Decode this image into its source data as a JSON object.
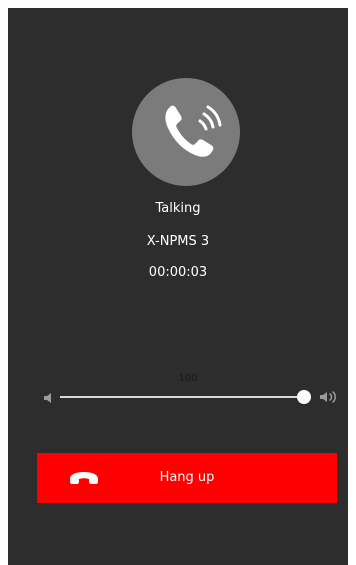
{
  "call": {
    "status": "Talking",
    "name": "X-NPMS 3",
    "timer": "00:00:03"
  },
  "volume": {
    "value": "100",
    "level": 1.0
  },
  "actions": {
    "hangup_label": "Hang up"
  },
  "icons": {
    "avatar": "phone-ringing-icon",
    "mute": "speaker-mute-icon",
    "loud": "speaker-loud-icon",
    "hangup": "phone-hangup-icon"
  },
  "colors": {
    "background": "#2d2d2d",
    "avatar": "#7b7b7b",
    "hangup": "#ff0000"
  }
}
